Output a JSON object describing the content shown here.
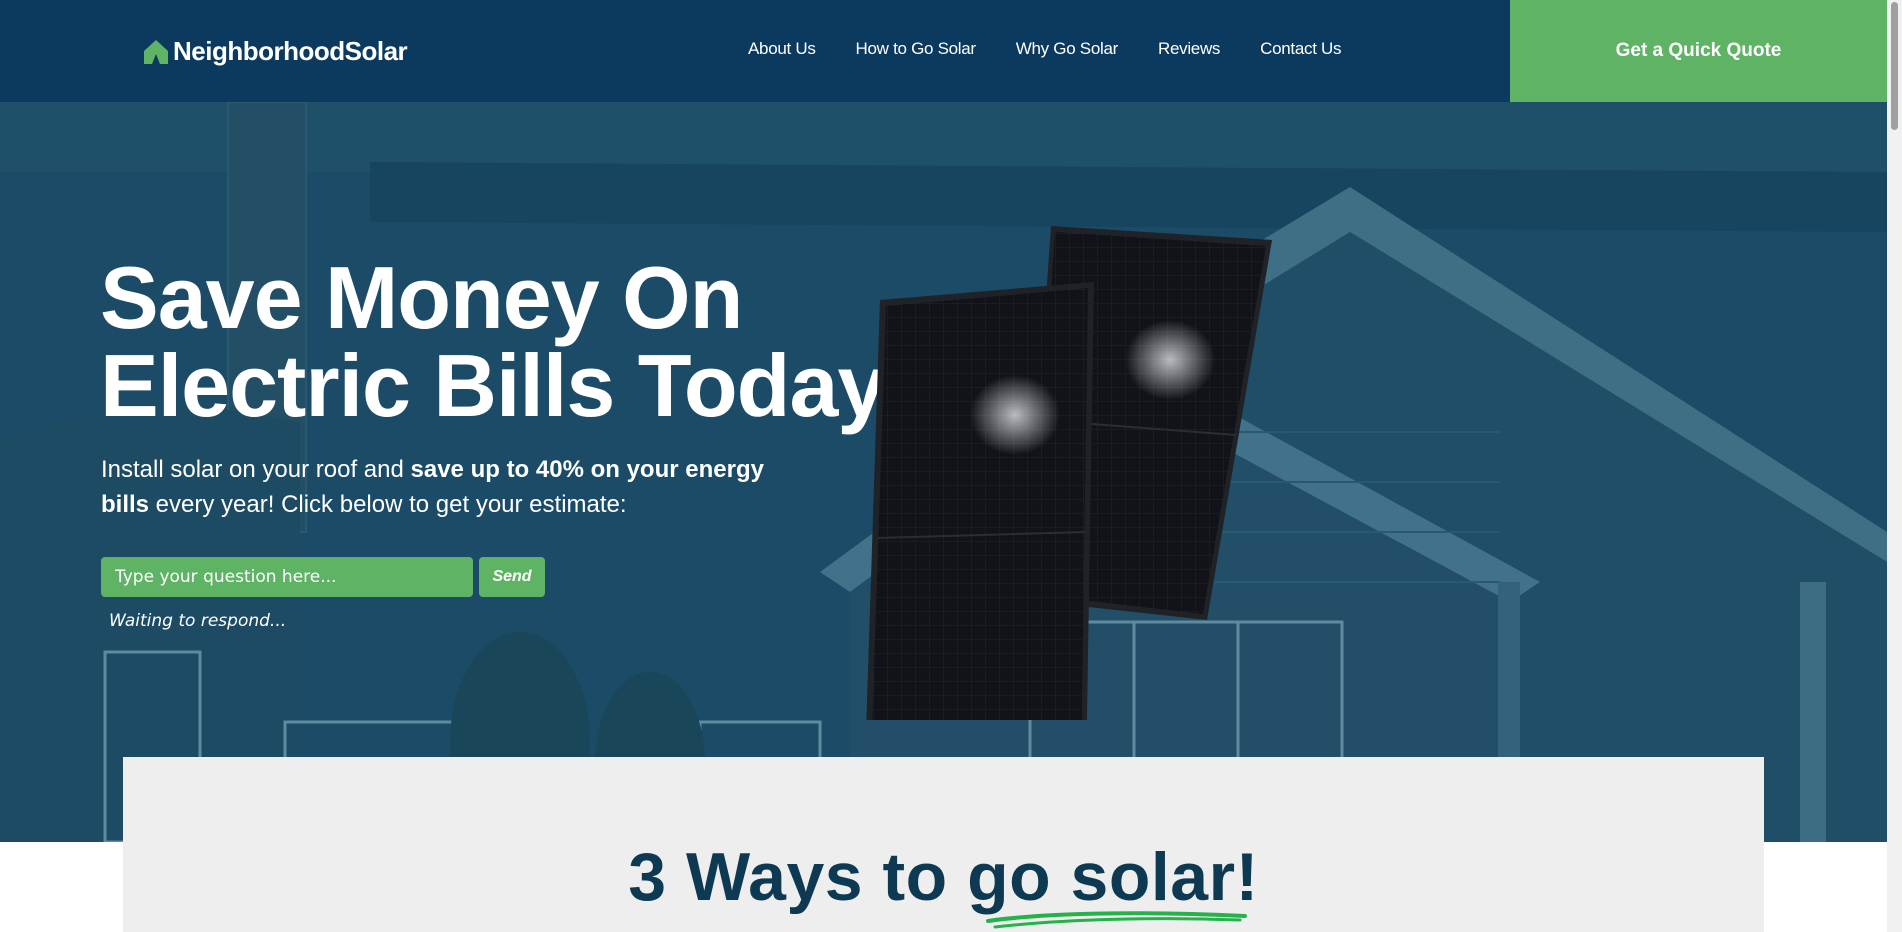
{
  "header": {
    "logo_text": "NeighborhoodSolar",
    "logo_icon": "house-icon",
    "nav": [
      {
        "label": "About Us"
      },
      {
        "label": "How to Go Solar"
      },
      {
        "label": "Why Go Solar"
      },
      {
        "label": "Reviews"
      },
      {
        "label": "Contact Us"
      }
    ],
    "cta_label": "Get a Quick Quote"
  },
  "hero": {
    "title_line1": "Save Money On",
    "title_line2": "Electric Bills Today",
    "subtitle_part1": "Install solar on your roof and ",
    "subtitle_bold1": "save up to 40% on your energy",
    "subtitle_bold2": "bills",
    "subtitle_part2": " every year! Click below to get your estimate:",
    "chat": {
      "placeholder": "Type your question here...",
      "value": "",
      "send_label": "Send",
      "status": "Waiting to respond..."
    }
  },
  "section": {
    "title_part1": "3 Ways to ",
    "title_part2": "go solar!"
  },
  "colors": {
    "navy": "#0c3a5e",
    "hero_teal": "#1b4b66",
    "green": "#5eb464",
    "card_bg": "#efeeee",
    "title_navy": "#0d3a52",
    "underline_green": "#24b24a"
  }
}
